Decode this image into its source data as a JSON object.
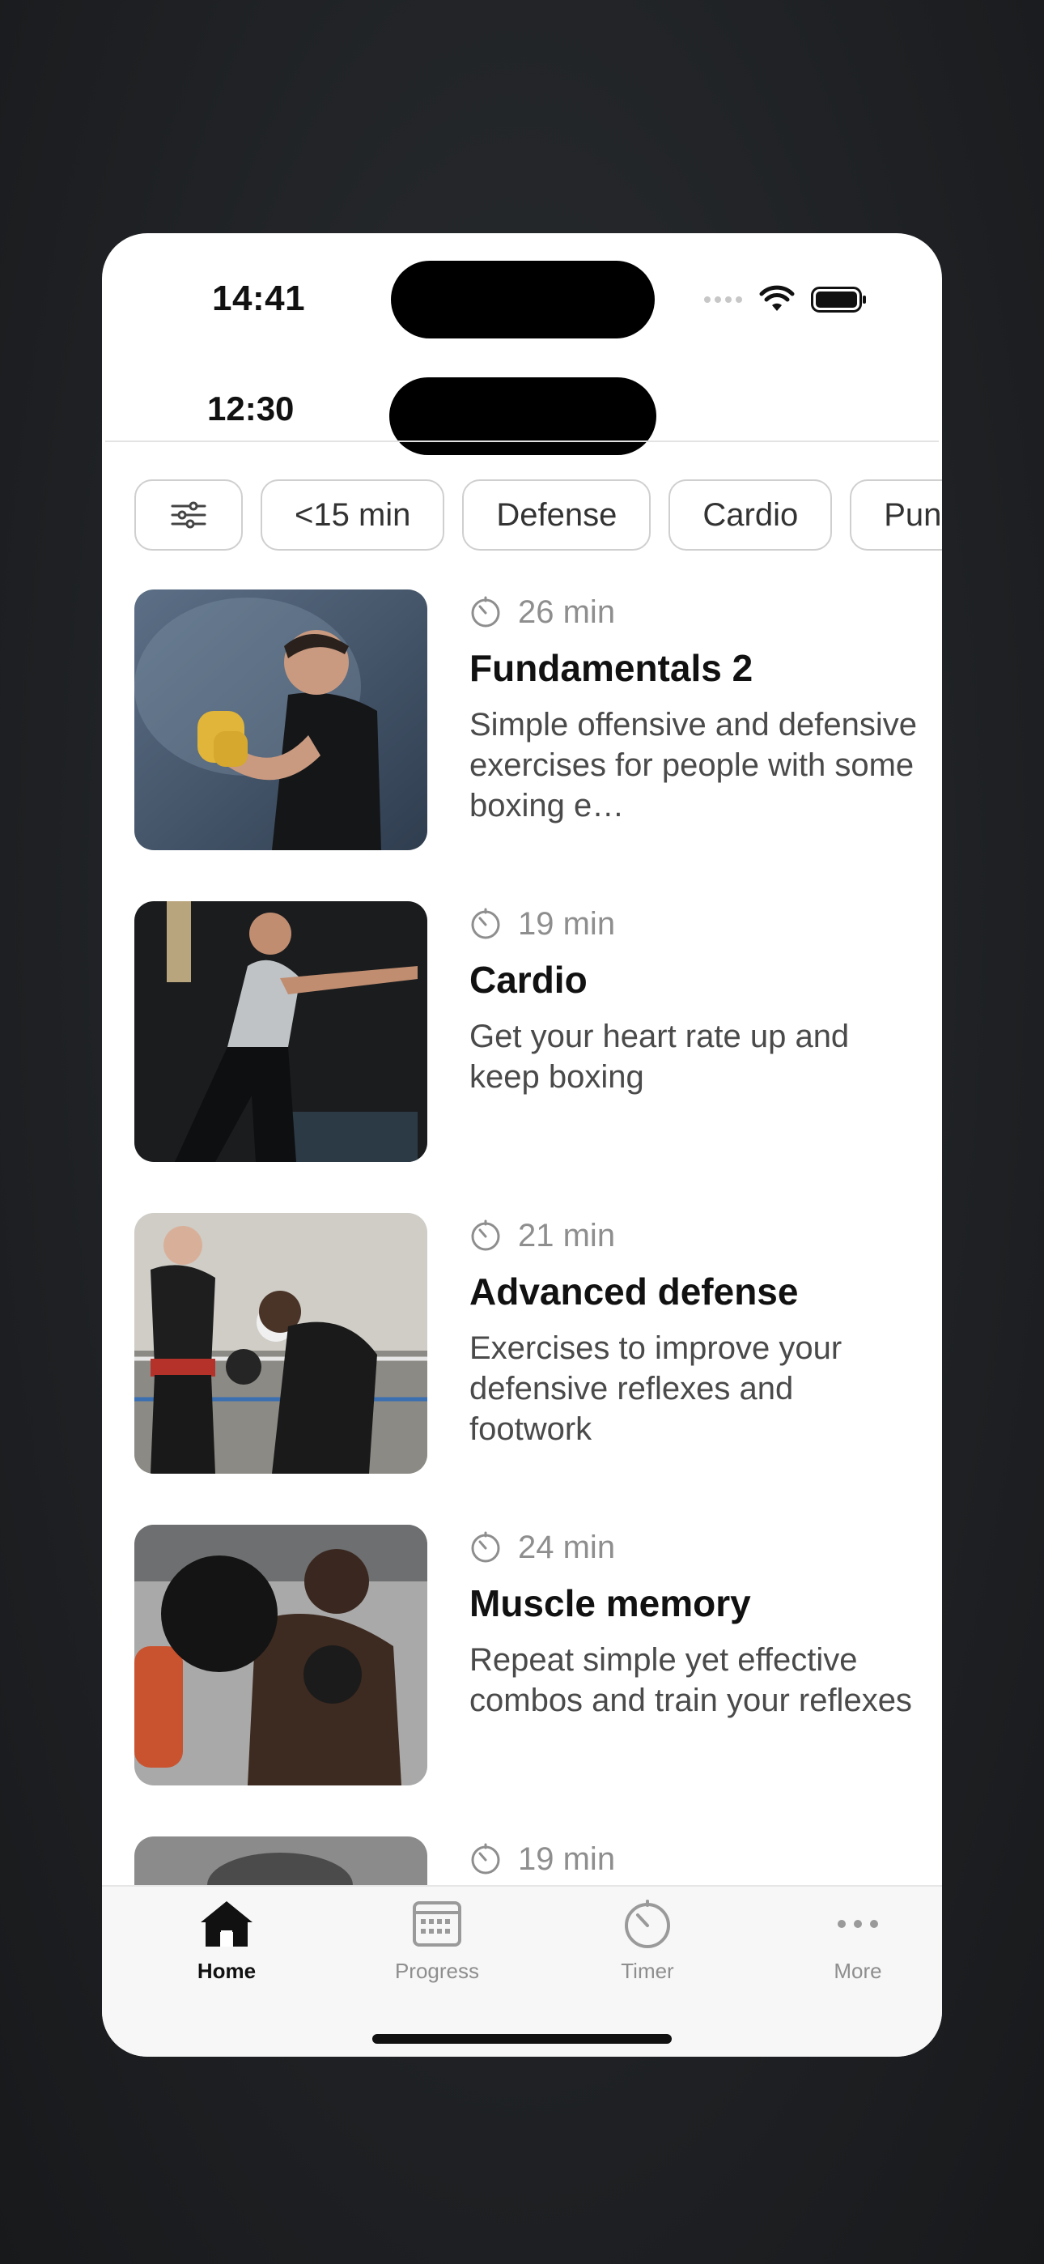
{
  "status": {
    "time_main": "14:41",
    "time_second": "12:30"
  },
  "chips": [
    "<15 min",
    "Defense",
    "Cardio",
    "Punches"
  ],
  "workouts": [
    {
      "duration": "26 min",
      "title": "Fundamentals 2",
      "description": "Simple offensive and defensive exercises for people with some boxing e…"
    },
    {
      "duration": "19 min",
      "title": "Cardio",
      "description": "Get your heart rate up and keep boxing"
    },
    {
      "duration": "21 min",
      "title": "Advanced defense",
      "description": "Exercises to improve your defensive reflexes and footwork"
    },
    {
      "duration": "24 min",
      "title": "Muscle memory",
      "description": "Repeat simple yet effective combos and train your reflexes"
    },
    {
      "duration": "19 min",
      "title": "",
      "description": ""
    }
  ],
  "tabs": [
    {
      "label": "Home",
      "icon": "home-icon",
      "active": true
    },
    {
      "label": "Progress",
      "icon": "calendar-icon",
      "active": false
    },
    {
      "label": "Timer",
      "icon": "timer-icon",
      "active": false
    },
    {
      "label": "More",
      "icon": "more-icon",
      "active": false
    }
  ],
  "colors": {
    "text_primary": "#111111",
    "text_secondary": "#8e8e8e",
    "chip_border": "#cfcfcf"
  }
}
